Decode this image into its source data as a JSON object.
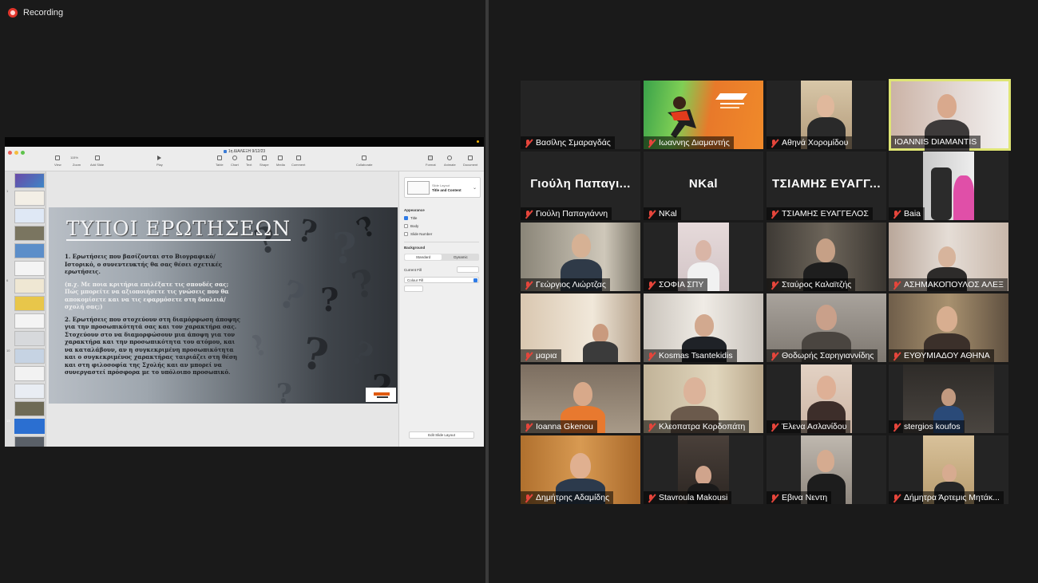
{
  "meeting": {
    "recording_label": "Recording"
  },
  "keynote": {
    "doc_title": "1η ΔΙΑΛΕΞΗ 9/12/23",
    "zoom_value": "115%",
    "toolbar": [
      "View",
      "Zoom",
      "Add Slide",
      "Play",
      "Table",
      "Chart",
      "Text",
      "Shape",
      "Media",
      "Comment",
      "Collaborate",
      "Format",
      "Animate",
      "Document"
    ],
    "thumb_numbers": [
      "1",
      "6",
      "10",
      "13"
    ],
    "inspector": {
      "slide_layout_caption": "Slide Layout",
      "slide_layout_value": "Title and Content",
      "appearance": "Appearance",
      "checks": [
        "Title",
        "Body",
        "Slide Number"
      ],
      "background": "Background",
      "segments": [
        "Standard",
        "Dynamic"
      ],
      "current_fill": "Current Fill",
      "fill_type": "Colour Fill",
      "edit_button": "Edit Slide Layout"
    }
  },
  "slide": {
    "title": "ΤΥΠΟΙ ΕΡΩΤΗΣΕΩΝ",
    "bullet1": "1.  Ερωτήσεις που βασίζονται στο Βιογραφικό/Ιστορικό, ο συνεντευκτής θα σας θέσει σχετικές ερωτήσεις.",
    "note": "(π.χ. Με ποια κριτήρια επιλέξατε τις σπουδές σας; Πώς μπορείτε να αξιοποιήσετε τις γνώσεις που θα αποκομίσετε και να τις εφαρμόσετε στη δουλειά/σχολή σας;)",
    "bullet2": "2.  Ερωτήσεις που στοχεύουν στη διαμόρφωση άποψης για την προσωπικότητά σας και τον χαρακτήρα σας. Στοχεύουν στο να διαμορφώσουν μια άποψη για τον χαρακτήρα και την προσωπικότητα του ατόμου, και να καταλάβουν, αν η συγκεκριμένη προσωπικότητα και ο συγκεκριμένος χαρακτήρας ταιριάζει στη θέση και στη φιλοσοφία της Σχολής και αν μπορεί να συνεργαστεί πρόσφορα με το υπόλοιπο προσωπικό."
  },
  "display_names": [
    "Γιούλη Παπαγι...",
    "NKal",
    "ΤΣΙΑΜΗΣ ΕΥΑΓΓ..."
  ],
  "participants": [
    "Βασίλης Σμαραγδάς",
    "Ιωαννης Διαμαντής",
    "Αθηνά Χορομίδου",
    "IOANNIS DIAMANTIS",
    "Γιούλη Παπαγιάννη",
    "NKal",
    "ΤΣΙΑΜΗΣ ΕΥΑΓΓΕΛΟΣ",
    "Baia",
    "Γεώργιος Λιώρτζας",
    "ΣΟΦΙΑ ΣΠΥ",
    "Σταύρος Καλαϊτζής",
    "ΑΣΗΜΑΚΟΠΟΥΛΟΣ ΑΛΕΞ",
    "μαρια",
    "Kosmas Tsantekidis",
    "Θοδωρής Σαρηγιαννίδης",
    "ΕΥΘΥΜΙΑΔΟΥ ΑΘΗΝΑ",
    "Ioanna Gkenou",
    "Κλεοπατρα Κορδοπάτη",
    "Έλενα Ασλανίδου",
    "stergios koufos",
    "Δημήτρης Αδαμίδης",
    "Stavroula Makousi",
    "Εβινα Νεντη",
    "Δήμητρα Άρτεμις Μητάκ..."
  ],
  "colors": {
    "background": "#1a1a1a",
    "active_speaker_border": "#dfe574",
    "muted_mic": "#e5453b",
    "recording_dot": "#e0352b",
    "accent_blue": "#2f7be6"
  }
}
